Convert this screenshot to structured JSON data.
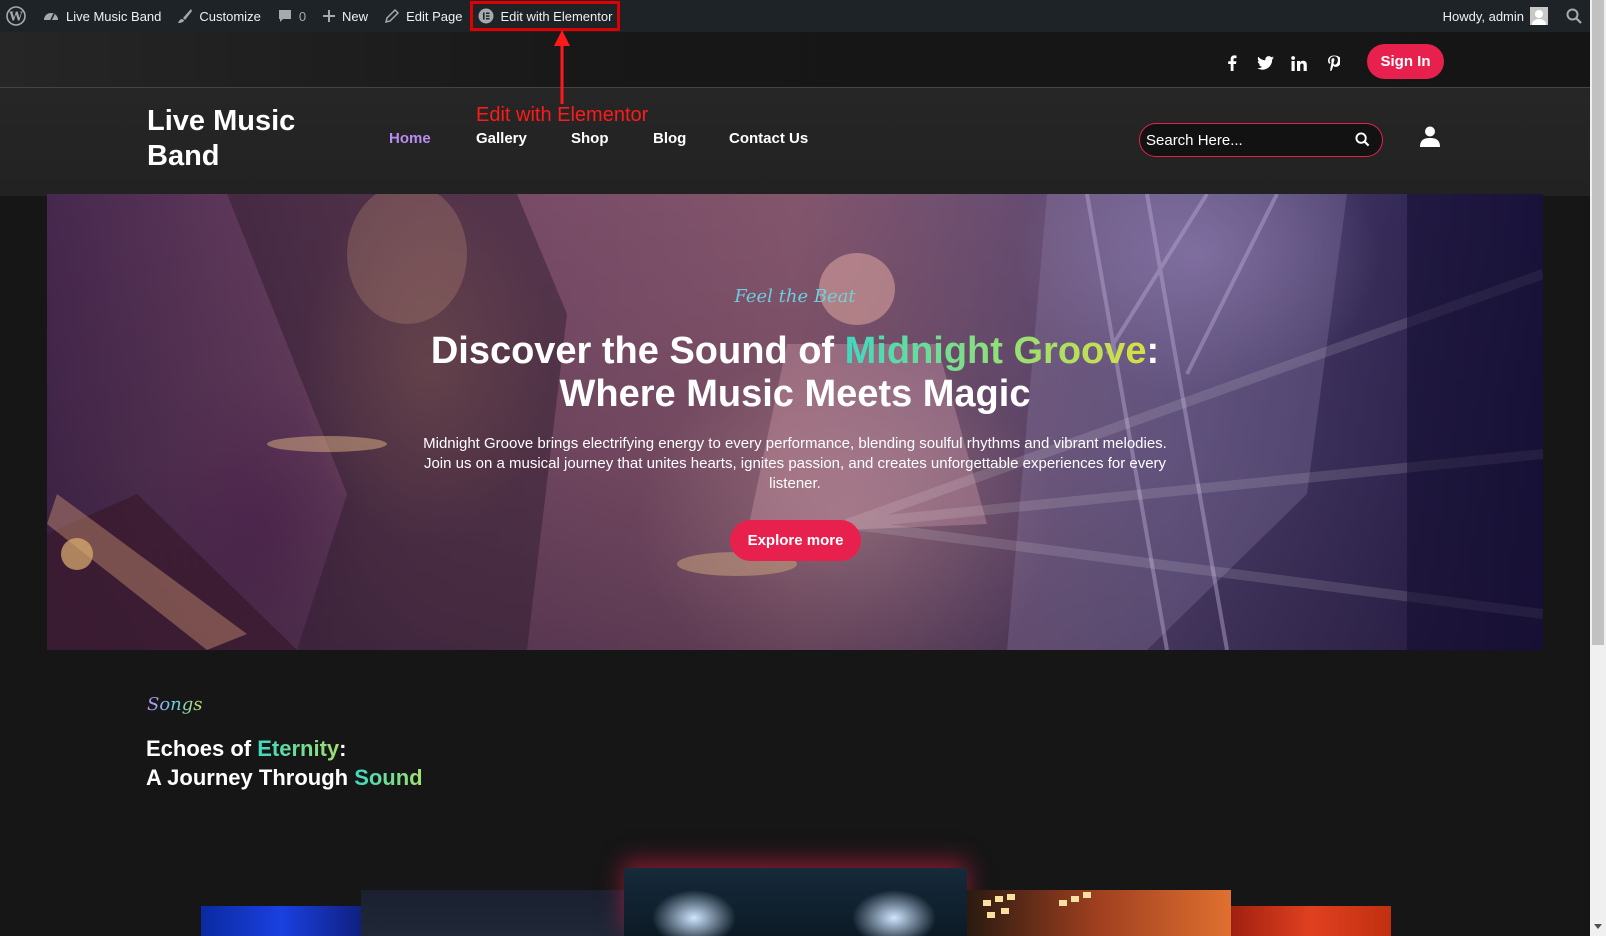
{
  "adminbar": {
    "site_name": "Live Music Band",
    "customize": "Customize",
    "comments_count": "0",
    "new": "New",
    "edit_page": "Edit Page",
    "edit_elementor": "Edit with Elementor",
    "howdy": "Howdy, admin"
  },
  "annotation": {
    "label": "Edit with Elementor",
    "color": "#ff1a1a"
  },
  "header": {
    "signin": "Sign In",
    "social_icons": [
      "facebook-icon",
      "twitter-icon",
      "linkedin-icon",
      "pinterest-icon"
    ],
    "logo": "Live Music Band",
    "nav": [
      "Home",
      "Gallery",
      "Shop",
      "Blog",
      "Contact Us"
    ],
    "active_nav": "Home",
    "search_placeholder": "Search Here...",
    "accent_color": "#e8204e"
  },
  "hero": {
    "tagline": "Feel the Beat",
    "title_pre": "Discover the Sound of ",
    "title_highlight": "Midnight Groove",
    "title_post": ":",
    "title_line2": "Where Music Meets Magic",
    "description": "Midnight Groove brings electrifying energy to every performance, blending soulful rhythms and vibrant melodies. Join us on a musical journey that unites hearts, ignites passion, and creates unforgettable experiences for every listener.",
    "button": "Explore more"
  },
  "songs": {
    "tag": "Songs",
    "title_pre": "Echoes of ",
    "title_highlight": "Eternity",
    "title_colon": ":",
    "title_line2_pre": "A Journey Through ",
    "title_line2_highlight": "Sound"
  }
}
